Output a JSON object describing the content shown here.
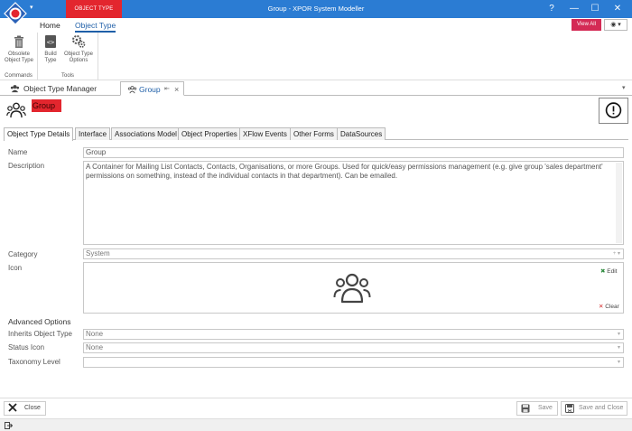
{
  "window": {
    "title": "Group - XPOR System Modeller",
    "context_tab": "OBJECT TYPE",
    "help_label": "?",
    "min_label": "—",
    "max_label": "☐",
    "close_label": "✕"
  },
  "ribbon": {
    "tabs": [
      "Home",
      "Object Type"
    ],
    "view_all": "View All",
    "groups": [
      {
        "label": "Commands",
        "buttons": [
          {
            "line1": "Obsolete",
            "line2": "Object Type"
          }
        ]
      },
      {
        "label": "Tools",
        "buttons": [
          {
            "line1": "Build",
            "line2": "Type"
          },
          {
            "line1": "Object Type",
            "line2": "Options"
          }
        ]
      }
    ]
  },
  "doc_tabs": {
    "manager": "Object Type Manager",
    "group": "Group",
    "pin": "⇤",
    "close": "×",
    "overflow": "▾"
  },
  "header": {
    "title": "Group"
  },
  "inner_tabs": [
    "Object Type Details",
    "Interface",
    "Associations Model",
    "Object Properties",
    "XFlow Events",
    "Other Forms",
    "DataSources"
  ],
  "form": {
    "name_label": "Name",
    "name_value": "Group",
    "description_label": "Description",
    "description_value": "A Container for Mailing List Contacts, Contacts, Organisations, or more Groups. Used for quick/easy permissions management (e.g. give group 'sales department' permissions on something, instead of the individual contacts in that department). Can be emailed.",
    "category_label": "Category",
    "category_value": "System",
    "icon_label": "Icon",
    "edit_label": "Edit",
    "clear_label": "Clear",
    "advanced_label": "Advanced Options",
    "inherits_label": "Inherits Object Type",
    "inherits_value": "None",
    "status_icon_label": "Status Icon",
    "status_icon_value": "None",
    "taxonomy_label": "Taxonomy Level",
    "taxonomy_value": ""
  },
  "footer": {
    "close": "Close",
    "save": "Save",
    "save_close": "Save and Close"
  },
  "colors": {
    "accent_blue": "#2b7cd3",
    "context_red": "#e3262e",
    "view_all_pink": "#d42a55"
  }
}
